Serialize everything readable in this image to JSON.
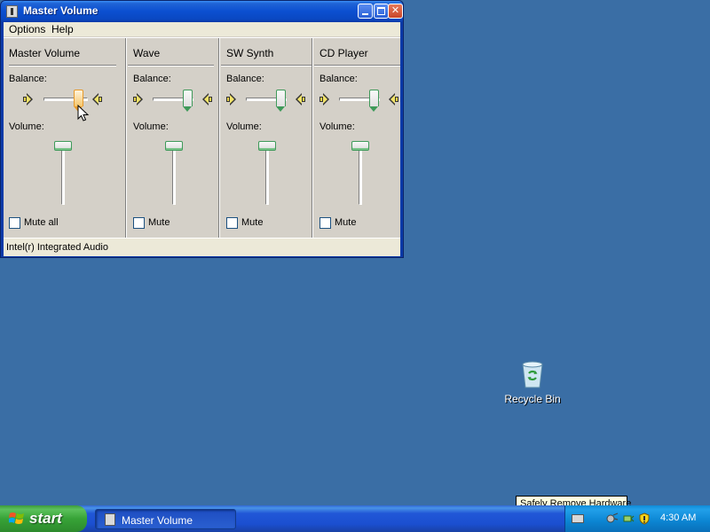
{
  "window": {
    "title": "Master Volume",
    "menu": {
      "options": "Options",
      "help": "Help"
    },
    "channels": [
      {
        "name": "Master Volume",
        "balance_label": "Balance:",
        "volume_label": "Volume:",
        "mute_label": "Mute all",
        "mute_checked": false,
        "balance_value": 0.6,
        "volume_value": 1.0,
        "active": true
      },
      {
        "name": "Wave",
        "balance_label": "Balance:",
        "volume_label": "Volume:",
        "mute_label": "Mute",
        "mute_checked": false,
        "balance_value": 0.75,
        "volume_value": 1.0
      },
      {
        "name": "SW Synth",
        "balance_label": "Balance:",
        "volume_label": "Volume:",
        "mute_label": "Mute",
        "mute_checked": false,
        "balance_value": 0.75,
        "volume_value": 1.0
      },
      {
        "name": "CD Player",
        "balance_label": "Balance:",
        "volume_label": "Volume:",
        "mute_label": "Mute",
        "mute_checked": false,
        "balance_value": 0.75,
        "volume_value": 1.0
      }
    ],
    "status": "Intel(r) Integrated Audio"
  },
  "desktop": {
    "icons": [
      {
        "label": "Recycle Bin",
        "icon": "recycle-bin-icon"
      }
    ],
    "background_color": "#3a6ea5"
  },
  "tooltip": {
    "text": "Safely Remove Hardware"
  },
  "taskbar": {
    "start_label": "start",
    "tasks": [
      {
        "label": "Master Volume"
      }
    ],
    "clock": "4:30 AM"
  }
}
